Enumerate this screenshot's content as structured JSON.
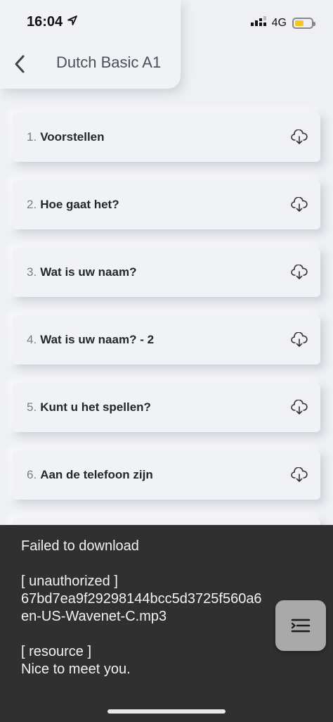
{
  "status_bar": {
    "time": "16:04",
    "network": "4G",
    "icons": [
      "location-arrow-icon",
      "signal-icon",
      "battery-icon"
    ],
    "battery_color": "#f3c623"
  },
  "header": {
    "title": "Dutch Basic A1",
    "back_icon": "chevron-left-icon"
  },
  "lessons": [
    {
      "num": "1.",
      "title": "Voorstellen"
    },
    {
      "num": "2.",
      "title": "Hoe gaat het?"
    },
    {
      "num": "3.",
      "title": "Wat is uw naam?"
    },
    {
      "num": "4.",
      "title": "Wat is uw naam? - 2"
    },
    {
      "num": "5.",
      "title": "Kunt u het spellen?"
    },
    {
      "num": "6.",
      "title": "Aan de telefoon zijn"
    },
    {
      "num": "",
      "title": ""
    }
  ],
  "snackbar": {
    "line1": "Failed to download",
    "line2": "[ unauthorized ]",
    "line3": "67bd7ea9f29298144bcc5d3725f560a6",
    "line4": "en-US-Wavenet-C.mp3",
    "line5": "[ resource ]",
    "line6": "Nice to meet you."
  },
  "fab": {
    "icon": "menu-lines-icon"
  }
}
